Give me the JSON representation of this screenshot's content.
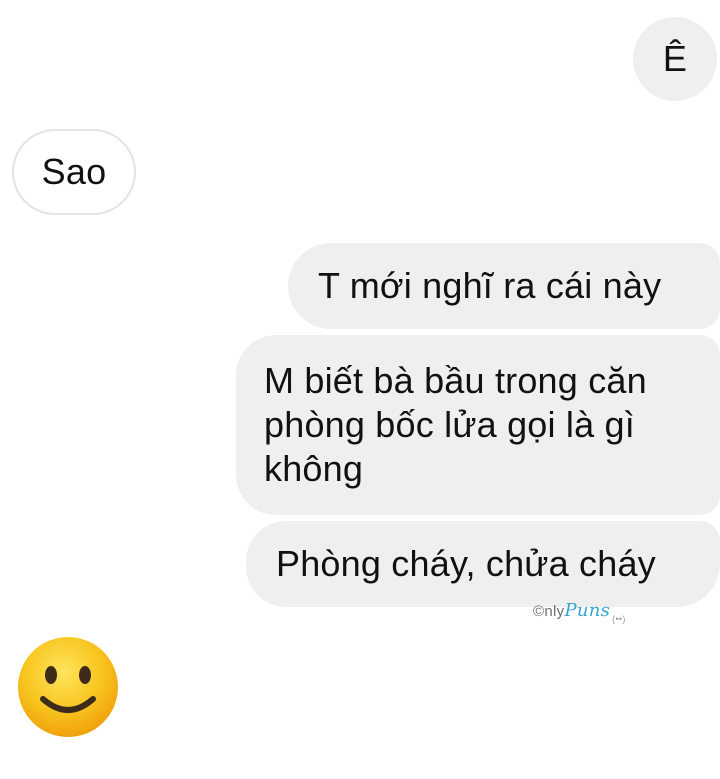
{
  "conversation": {
    "messages": [
      {
        "sender": "me",
        "lines": [
          "Ê"
        ]
      },
      {
        "sender": "other",
        "lines": [
          "Sao"
        ]
      },
      {
        "sender": "me",
        "lines": [
          "T mới nghĩ ra cái này"
        ]
      },
      {
        "sender": "me",
        "lines": [
          "M biết bà bầu trong căn",
          "phòng bốc lửa gọi là gì",
          "không"
        ]
      },
      {
        "sender": "me",
        "lines": [
          "Phòng cháy, chửa cháy"
        ]
      }
    ],
    "reaction_emoji": "slightly-smiling-face-emoji"
  },
  "watermark": {
    "prefix": "©nly",
    "brand": "Puns",
    "mark": "(••)"
  },
  "colors": {
    "outgoing_bubble": "#efeff0",
    "incoming_bubble": "#ffffff",
    "incoming_border": "#e3e3e3",
    "text": "#111111",
    "watermark_brand": "#31a7d6",
    "emoji_face": "#f8c51f"
  }
}
